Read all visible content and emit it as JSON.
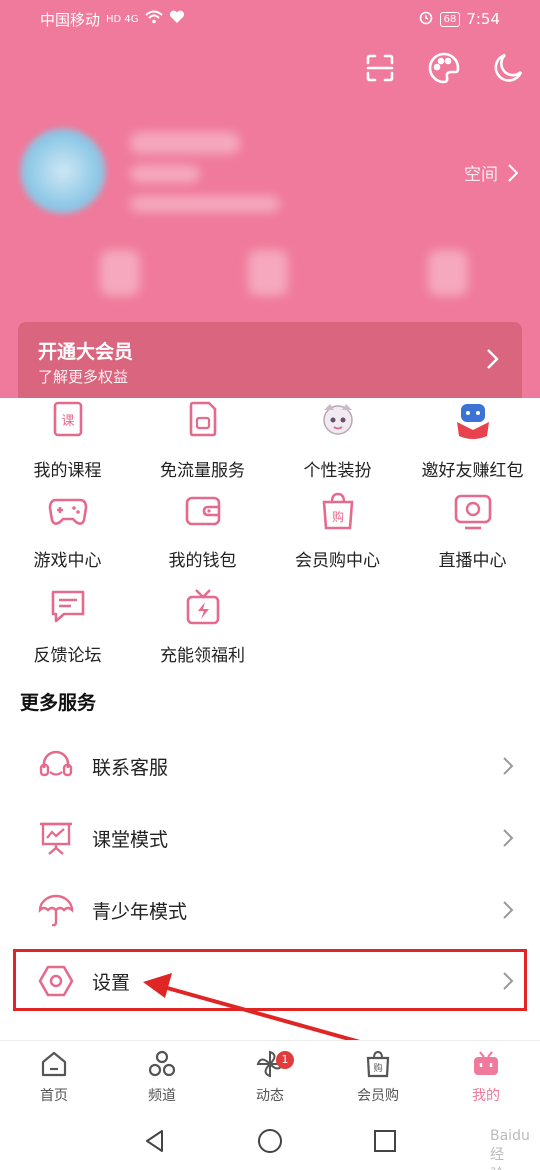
{
  "status_bar": {
    "carrier": "中国移动",
    "net": "HD 4G",
    "battery": "68",
    "time": "7:54"
  },
  "header": {
    "space_link": "空间",
    "vip_title": "开通大会员",
    "vip_subtitle": "了解更多权益"
  },
  "grid": [
    {
      "label": "我的课程",
      "icon": "course-icon"
    },
    {
      "label": "免流量服务",
      "icon": "sim-card-icon"
    },
    {
      "label": "个性装扮",
      "icon": "avatar-sticker-icon"
    },
    {
      "label": "邀好友赚红包",
      "icon": "red-envelope-icon"
    },
    {
      "label": "游戏中心",
      "icon": "gamepad-icon"
    },
    {
      "label": "我的钱包",
      "icon": "wallet-icon"
    },
    {
      "label": "会员购中心",
      "icon": "shopping-bag-icon"
    },
    {
      "label": "直播中心",
      "icon": "live-tv-icon"
    },
    {
      "label": "反馈论坛",
      "icon": "feedback-icon"
    },
    {
      "label": "充能领福利",
      "icon": "gift-box-icon"
    }
  ],
  "more_services": {
    "title": "更多服务",
    "items": [
      {
        "label": "联系客服",
        "icon": "headset-icon"
      },
      {
        "label": "课堂模式",
        "icon": "classroom-icon"
      },
      {
        "label": "青少年模式",
        "icon": "umbrella-icon"
      },
      {
        "label": "设置",
        "icon": "settings-hex-icon"
      }
    ]
  },
  "tabbar": {
    "tabs": [
      {
        "label": "首页",
        "icon": "home-icon"
      },
      {
        "label": "频道",
        "icon": "channels-icon"
      },
      {
        "label": "动态",
        "icon": "pinwheel-icon",
        "badge": "1"
      },
      {
        "label": "会员购",
        "icon": "shop-bag-icon"
      },
      {
        "label": "我的",
        "icon": "tv-face-icon",
        "active": true
      }
    ]
  },
  "watermark": "Baidu 经验",
  "colors": {
    "brand_pink": "#f07a9b",
    "highlight_red": "#e02525"
  }
}
